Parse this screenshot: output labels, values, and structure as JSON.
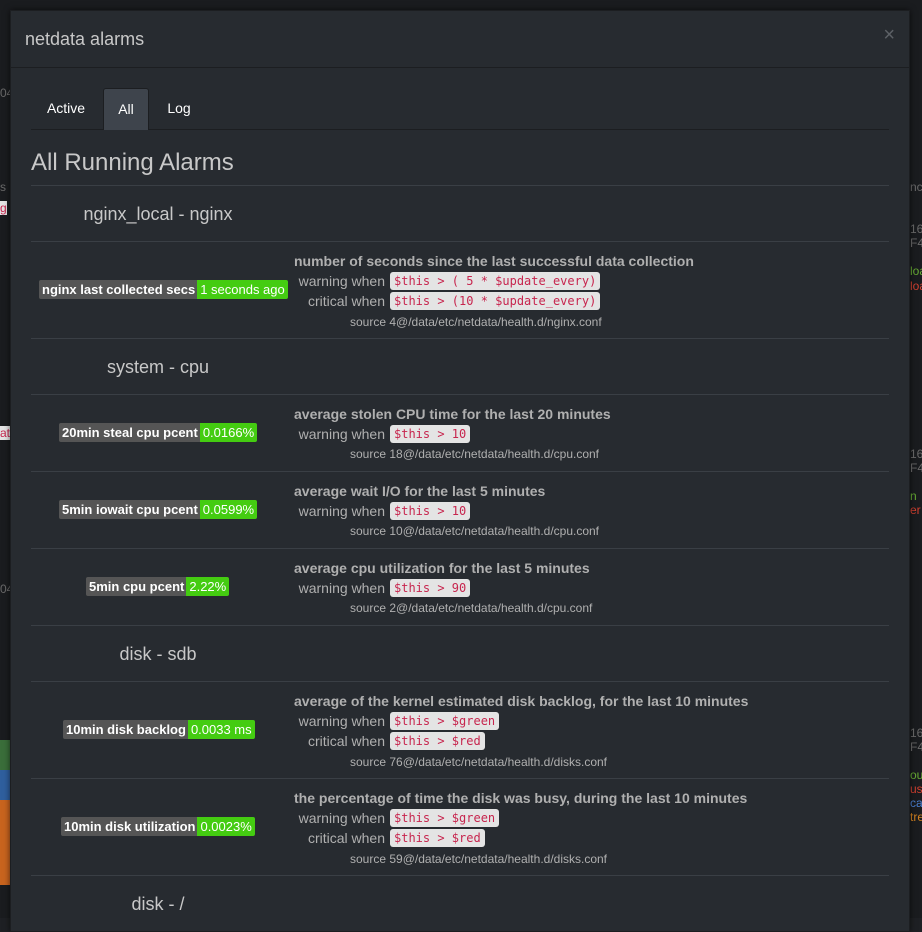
{
  "modal": {
    "title": "netdata alarms",
    "close_icon": "×"
  },
  "tabs": [
    {
      "label": "Active"
    },
    {
      "label": "All",
      "active": true
    },
    {
      "label": "Log"
    }
  ],
  "section_title": "All Running Alarms",
  "groups": [
    {
      "title": "nginx_local - nginx",
      "alarms": [
        {
          "badge_label": "nginx last collected secs",
          "badge_value": "1 seconds ago",
          "description": "number of seconds since the last successful data collection",
          "warning_label": "warning when",
          "warning_expr": "$this > ( 5 * $update_every)",
          "critical_label": "critical when",
          "critical_expr": "$this > (10 * $update_every)",
          "source": "source 4@/data/etc/netdata/health.d/nginx.conf"
        }
      ]
    },
    {
      "title": "system - cpu",
      "alarms": [
        {
          "badge_label": "20min steal cpu pcent",
          "badge_value": "0.0166%",
          "description": "average stolen CPU time for the last 20 minutes",
          "warning_label": "warning when",
          "warning_expr": "$this > 10",
          "source": "source 18@/data/etc/netdata/health.d/cpu.conf"
        },
        {
          "badge_label": "5min iowait cpu pcent",
          "badge_value": "0.0599%",
          "description": "average wait I/O for the last 5 minutes",
          "warning_label": "warning when",
          "warning_expr": "$this > 10",
          "source": "source 10@/data/etc/netdata/health.d/cpu.conf"
        },
        {
          "badge_label": "5min cpu pcent",
          "badge_value": "2.22%",
          "description": "average cpu utilization for the last 5 minutes",
          "warning_label": "warning when",
          "warning_expr": "$this > 90",
          "source": "source 2@/data/etc/netdata/health.d/cpu.conf"
        }
      ]
    },
    {
      "title": "disk - sdb",
      "alarms": [
        {
          "badge_label": "10min disk backlog",
          "badge_value": "0.0033 ms",
          "description": "average of the kernel estimated disk backlog, for the last 10 minutes",
          "warning_label": "warning when",
          "warning_expr": "$this > $green",
          "critical_label": "critical when",
          "critical_expr": "$this > $red",
          "source": "source 76@/data/etc/netdata/health.d/disks.conf"
        },
        {
          "badge_label": "10min disk utilization",
          "badge_value": "0.0023%",
          "description": "the percentage of time the disk was busy, during the last 10 minutes",
          "warning_label": "warning when",
          "warning_expr": "$this > $green",
          "critical_label": "critical when",
          "critical_expr": "$this > $red",
          "source": "source 59@/data/etc/netdata/health.d/disks.conf"
        }
      ]
    },
    {
      "title": "disk - /",
      "alarms": []
    }
  ],
  "background_fragments": {
    "left": [
      "04",
      "s",
      "g",
      "at",
      "04"
    ],
    "right": [
      "nc",
      "16/",
      "F4",
      "loa",
      "loa",
      "16/",
      "F4",
      "n",
      "er",
      "16/",
      "F4",
      "ou",
      "us",
      "ca",
      "tre"
    ]
  },
  "colors": {
    "badge_label_bg": "#555555",
    "badge_value_bg": "#44cc11",
    "code_text": "#c7254e",
    "code_bg": "#e4e4e4"
  }
}
